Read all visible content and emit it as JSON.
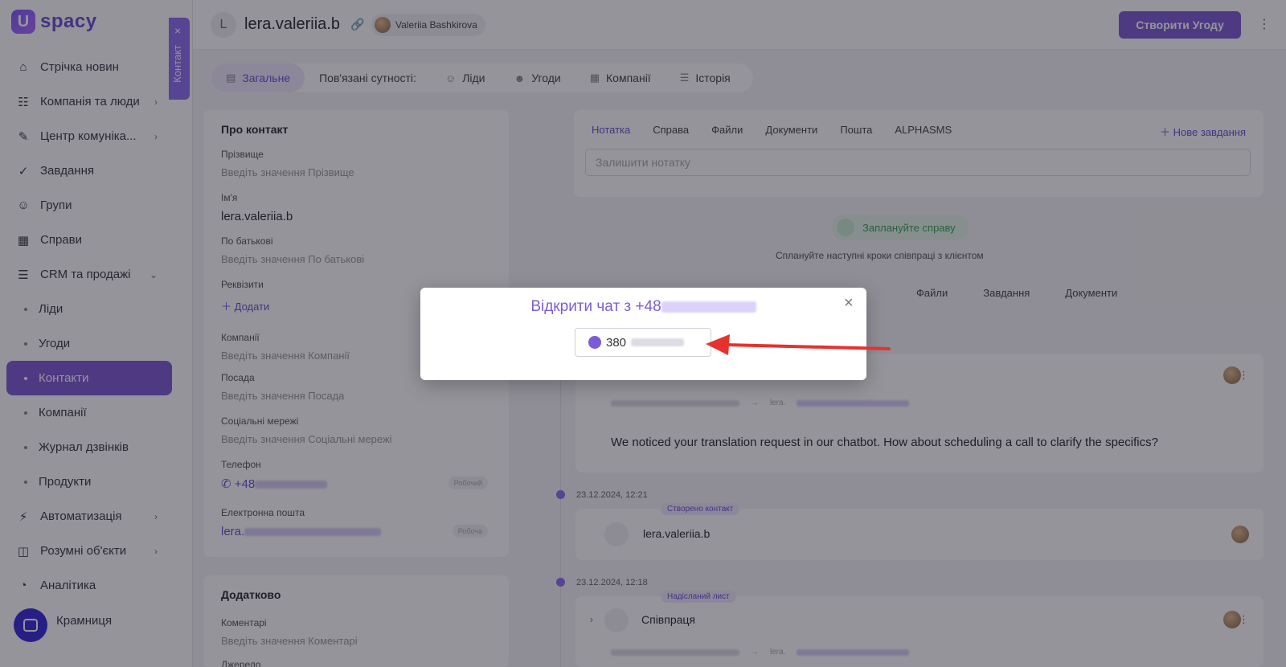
{
  "app": {
    "logo_mark": "U",
    "logo_text": "spacy"
  },
  "sidebar": {
    "items": [
      {
        "label": "Стрічка новин",
        "icon": "home-icon"
      },
      {
        "label": "Компанія та люди",
        "icon": "people-icon",
        "chevron": true
      },
      {
        "label": "Центр комуніка...",
        "icon": "chat-icon",
        "chevron": true
      },
      {
        "label": "Завдання",
        "icon": "task-icon"
      },
      {
        "label": "Групи",
        "icon": "group-icon"
      },
      {
        "label": "Справи",
        "icon": "calendar-icon"
      },
      {
        "label": "CRM та продажі",
        "icon": "crm-icon",
        "chevron_down": true
      }
    ],
    "sub_items": [
      {
        "label": "Ліди"
      },
      {
        "label": "Угоди"
      },
      {
        "label": "Контакти",
        "active": true
      },
      {
        "label": "Компанії"
      },
      {
        "label": "Журнал дзвінків"
      },
      {
        "label": "Продукти"
      }
    ],
    "items_bottom": [
      {
        "label": "Автоматизація",
        "icon": "lightning-icon",
        "chevron": true
      },
      {
        "label": "Розумні об'єкти",
        "icon": "cube-icon",
        "chevron": true
      },
      {
        "label": "Аналітика",
        "icon": "chart-icon"
      }
    ],
    "bottom_label": "Крамниця",
    "vertical_tab": {
      "label": "Контакт",
      "close": "×"
    }
  },
  "header": {
    "avatar_letter": "L",
    "title": "lera.valeriia.b",
    "owner": "Valeriia Bashkirova",
    "create_button": "Створити Угоду",
    "kebab": "⋮"
  },
  "tabs": {
    "general": "Загальне",
    "related_label": "Пов'язані сутності:",
    "leads": "Ліди",
    "deals": "Угоди",
    "companies": "Компанії",
    "history": "Історія"
  },
  "about": {
    "title": "Про контакт",
    "fields": [
      {
        "label": "Прізвище",
        "value": "Введіть значення Прізвище"
      },
      {
        "label": "Ім'я",
        "value": "lera.valeriia.b"
      },
      {
        "label": "По батькові",
        "value": "Введіть значення По батькові"
      },
      {
        "label": "Реквізити",
        "value": "Додати"
      },
      {
        "label": "Компанії",
        "value": "Введіть значення Компанії"
      },
      {
        "label": "Посада",
        "value": "Введіть значення Посада"
      },
      {
        "label": "Соціальні мережі",
        "value": "Введіть значення Соціальні мережі"
      },
      {
        "label": "Телефон",
        "value": "+48",
        "tag": "Робочий"
      },
      {
        "label": "Електронна пошта",
        "value": "lera.",
        "tag": "Робоча"
      }
    ]
  },
  "extra": {
    "title": "Додатково",
    "fields": [
      {
        "label": "Коментарі",
        "value": "Введіть значення Коментарі"
      },
      {
        "label": "Джерело"
      }
    ]
  },
  "notes": {
    "tabs": [
      "Нотатка",
      "Справа",
      "Файли",
      "Документи",
      "Пошта",
      "ALPHASMS"
    ],
    "new_task": "Нове завдання",
    "placeholder": "Залишити нотатку"
  },
  "plan": {
    "button": "Заплануйте справу",
    "hint": "Сплануйте наступні кроки співпраці з клієнтом"
  },
  "filters": [
    "Файли",
    "Завдання",
    "Документи"
  ],
  "timeline": {
    "message": "We noticed your translation request in our chatbot. How about scheduling a call to clarify the specifics?",
    "email_prefix": "lera.",
    "events": [
      {
        "date": "23.12.2024, 12:21",
        "badge": "Створено контакт",
        "title": "lera.valeriia.b"
      },
      {
        "date": "23.12.2024, 12:18",
        "badge": "Надісланий лист",
        "title": "Співпраця"
      }
    ]
  },
  "modal": {
    "title_prefix": "Відкрити чат з +48",
    "close": "×",
    "phone_prefix": "380"
  },
  "colors": {
    "accent": "#7c5cd6",
    "arrow": "#e5322d",
    "green": "#3aa35a"
  }
}
